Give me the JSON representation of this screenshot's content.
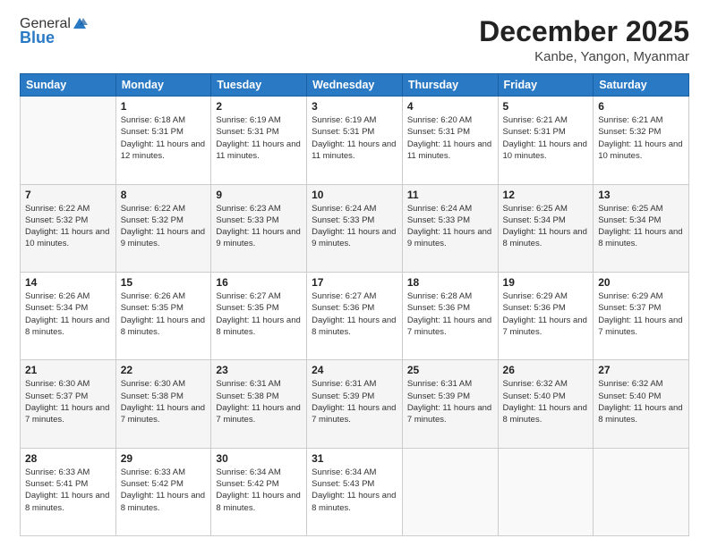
{
  "logo": {
    "general": "General",
    "blue": "Blue"
  },
  "header": {
    "title": "December 2025",
    "subtitle": "Kanbe, Yangon, Myanmar"
  },
  "weekdays": [
    "Sunday",
    "Monday",
    "Tuesday",
    "Wednesday",
    "Thursday",
    "Friday",
    "Saturday"
  ],
  "weeks": [
    [
      {
        "day": null
      },
      {
        "day": 1,
        "sunrise": "6:18 AM",
        "sunset": "5:31 PM",
        "daylight": "11 hours and 12 minutes."
      },
      {
        "day": 2,
        "sunrise": "6:19 AM",
        "sunset": "5:31 PM",
        "daylight": "11 hours and 11 minutes."
      },
      {
        "day": 3,
        "sunrise": "6:19 AM",
        "sunset": "5:31 PM",
        "daylight": "11 hours and 11 minutes."
      },
      {
        "day": 4,
        "sunrise": "6:20 AM",
        "sunset": "5:31 PM",
        "daylight": "11 hours and 11 minutes."
      },
      {
        "day": 5,
        "sunrise": "6:21 AM",
        "sunset": "5:31 PM",
        "daylight": "11 hours and 10 minutes."
      },
      {
        "day": 6,
        "sunrise": "6:21 AM",
        "sunset": "5:32 PM",
        "daylight": "11 hours and 10 minutes."
      }
    ],
    [
      {
        "day": 7,
        "sunrise": "6:22 AM",
        "sunset": "5:32 PM",
        "daylight": "11 hours and 10 minutes."
      },
      {
        "day": 8,
        "sunrise": "6:22 AM",
        "sunset": "5:32 PM",
        "daylight": "11 hours and 9 minutes."
      },
      {
        "day": 9,
        "sunrise": "6:23 AM",
        "sunset": "5:33 PM",
        "daylight": "11 hours and 9 minutes."
      },
      {
        "day": 10,
        "sunrise": "6:24 AM",
        "sunset": "5:33 PM",
        "daylight": "11 hours and 9 minutes."
      },
      {
        "day": 11,
        "sunrise": "6:24 AM",
        "sunset": "5:33 PM",
        "daylight": "11 hours and 9 minutes."
      },
      {
        "day": 12,
        "sunrise": "6:25 AM",
        "sunset": "5:34 PM",
        "daylight": "11 hours and 8 minutes."
      },
      {
        "day": 13,
        "sunrise": "6:25 AM",
        "sunset": "5:34 PM",
        "daylight": "11 hours and 8 minutes."
      }
    ],
    [
      {
        "day": 14,
        "sunrise": "6:26 AM",
        "sunset": "5:34 PM",
        "daylight": "11 hours and 8 minutes."
      },
      {
        "day": 15,
        "sunrise": "6:26 AM",
        "sunset": "5:35 PM",
        "daylight": "11 hours and 8 minutes."
      },
      {
        "day": 16,
        "sunrise": "6:27 AM",
        "sunset": "5:35 PM",
        "daylight": "11 hours and 8 minutes."
      },
      {
        "day": 17,
        "sunrise": "6:27 AM",
        "sunset": "5:36 PM",
        "daylight": "11 hours and 8 minutes."
      },
      {
        "day": 18,
        "sunrise": "6:28 AM",
        "sunset": "5:36 PM",
        "daylight": "11 hours and 7 minutes."
      },
      {
        "day": 19,
        "sunrise": "6:29 AM",
        "sunset": "5:36 PM",
        "daylight": "11 hours and 7 minutes."
      },
      {
        "day": 20,
        "sunrise": "6:29 AM",
        "sunset": "5:37 PM",
        "daylight": "11 hours and 7 minutes."
      }
    ],
    [
      {
        "day": 21,
        "sunrise": "6:30 AM",
        "sunset": "5:37 PM",
        "daylight": "11 hours and 7 minutes."
      },
      {
        "day": 22,
        "sunrise": "6:30 AM",
        "sunset": "5:38 PM",
        "daylight": "11 hours and 7 minutes."
      },
      {
        "day": 23,
        "sunrise": "6:31 AM",
        "sunset": "5:38 PM",
        "daylight": "11 hours and 7 minutes."
      },
      {
        "day": 24,
        "sunrise": "6:31 AM",
        "sunset": "5:39 PM",
        "daylight": "11 hours and 7 minutes."
      },
      {
        "day": 25,
        "sunrise": "6:31 AM",
        "sunset": "5:39 PM",
        "daylight": "11 hours and 7 minutes."
      },
      {
        "day": 26,
        "sunrise": "6:32 AM",
        "sunset": "5:40 PM",
        "daylight": "11 hours and 8 minutes."
      },
      {
        "day": 27,
        "sunrise": "6:32 AM",
        "sunset": "5:40 PM",
        "daylight": "11 hours and 8 minutes."
      }
    ],
    [
      {
        "day": 28,
        "sunrise": "6:33 AM",
        "sunset": "5:41 PM",
        "daylight": "11 hours and 8 minutes."
      },
      {
        "day": 29,
        "sunrise": "6:33 AM",
        "sunset": "5:42 PM",
        "daylight": "11 hours and 8 minutes."
      },
      {
        "day": 30,
        "sunrise": "6:34 AM",
        "sunset": "5:42 PM",
        "daylight": "11 hours and 8 minutes."
      },
      {
        "day": 31,
        "sunrise": "6:34 AM",
        "sunset": "5:43 PM",
        "daylight": "11 hours and 8 minutes."
      },
      {
        "day": null
      },
      {
        "day": null
      },
      {
        "day": null
      }
    ]
  ],
  "labels": {
    "sunrise": "Sunrise:",
    "sunset": "Sunset:",
    "daylight": "Daylight:"
  }
}
